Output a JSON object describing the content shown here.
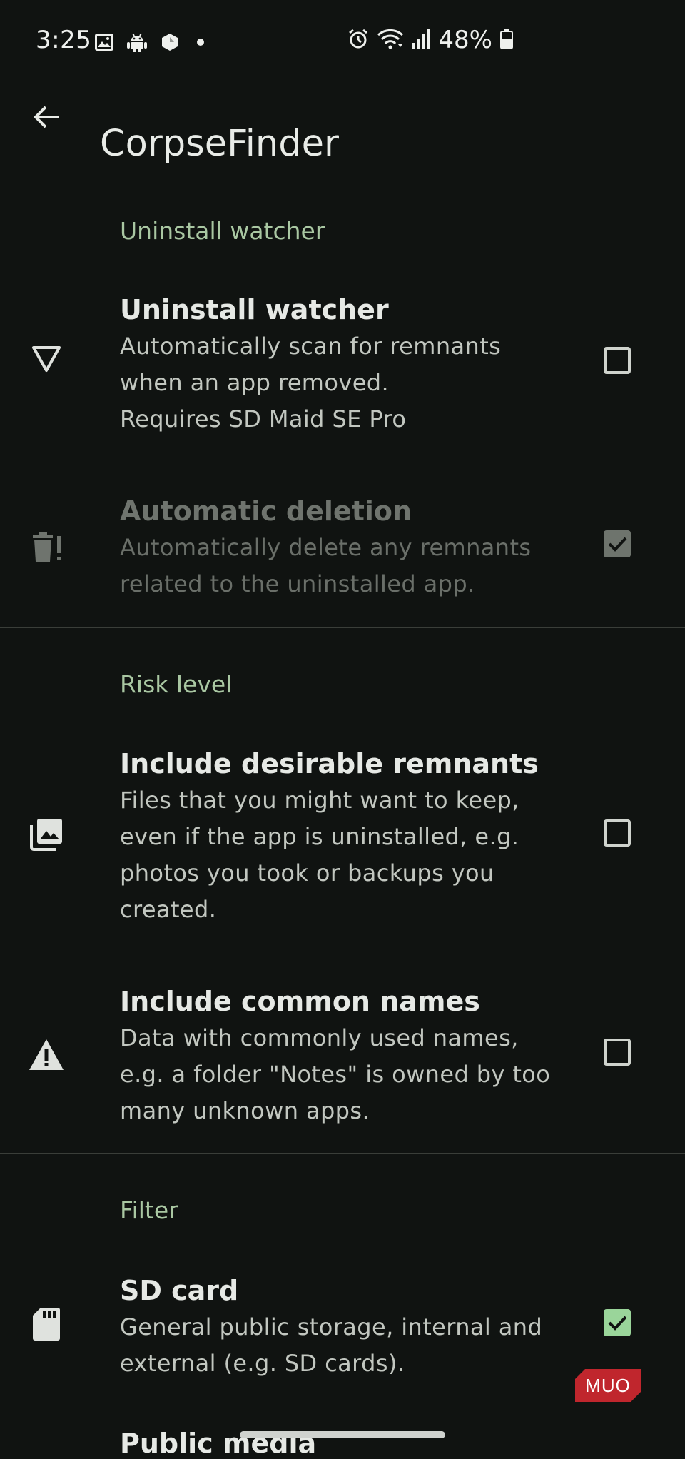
{
  "status_bar": {
    "time": "3:25",
    "battery_percent": "48%",
    "left_icons": [
      "image-icon",
      "android-icon",
      "app-icon",
      "dot-icon"
    ],
    "right_icons": [
      "alarm-icon",
      "wifi-icon",
      "signal-icon",
      "battery-icon"
    ]
  },
  "app_bar": {
    "title": "CorpseFinder"
  },
  "sections": {
    "uninstall_watcher": {
      "header": "Uninstall watcher",
      "watcher": {
        "title": "Uninstall watcher",
        "summary": "Automatically scan for remnants\nwhen an app removed.\nRequires SD Maid SE Pro",
        "checked": false,
        "icon": "triangle-down-outline-icon"
      },
      "auto_delete": {
        "title": "Automatic deletion",
        "summary": "Automatically delete any remnants\nrelated to the uninstalled app.",
        "checked": true,
        "enabled": false,
        "icon": "trash-alert-icon"
      }
    },
    "risk_level": {
      "header": "Risk level",
      "desirable": {
        "title": "Include desirable remnants",
        "summary": "Files that you might want to keep,\neven if the app is uninstalled, e.g.\nphotos you took or backups you\ncreated.",
        "checked": false,
        "icon": "image-multiple-icon"
      },
      "common_names": {
        "title": "Include common names",
        "summary": "Data with commonly used names,\ne.g. a folder \"Notes\" is owned by too\nmany unknown apps.",
        "checked": false,
        "icon": "warning-icon"
      }
    },
    "filter": {
      "header": "Filter",
      "sd_card": {
        "title": "SD card",
        "summary": "General public storage, internal and\nexternal (e.g. SD cards).",
        "checked": true,
        "icon": "sd-card-icon"
      },
      "next_item_partial": "Public media"
    }
  },
  "watermark": "MUO",
  "colors": {
    "background": "#101311",
    "section_header": "#a9c7a2",
    "checkbox_checked": "#9ad59a",
    "divider": "#3a3e39"
  }
}
